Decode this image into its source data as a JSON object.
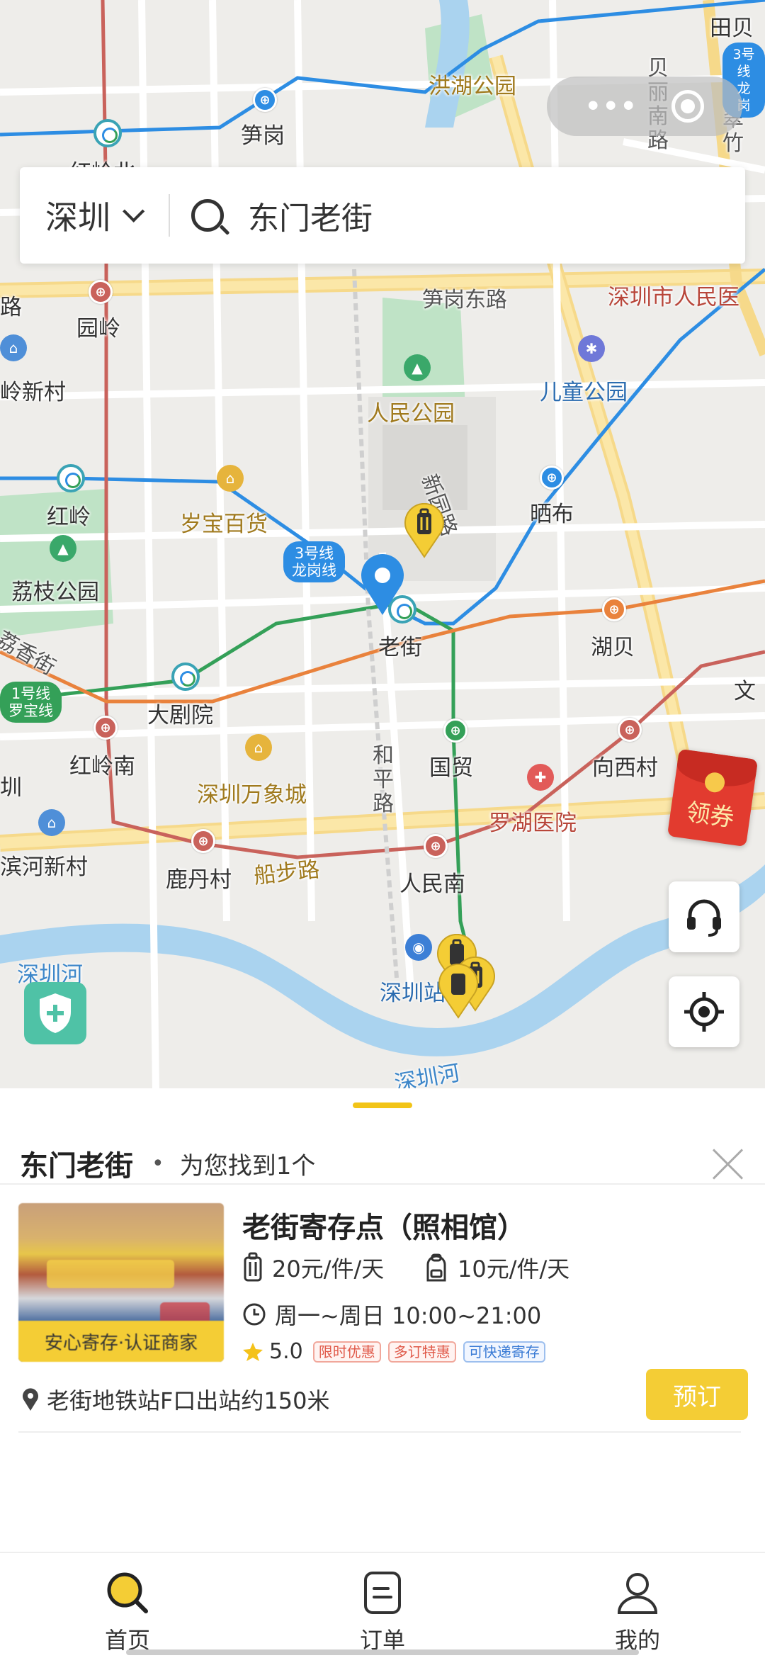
{
  "search": {
    "city": "深圳",
    "query": "东门老街"
  },
  "map": {
    "labels": {
      "honghu_park": "洪湖公园",
      "sungang": "笋岗",
      "hongling_north": "红岭北",
      "sungang_east_rd": "笋岗东路",
      "shenzhen_peoples_hospital": "深圳市人民医",
      "yuanling": "园岭",
      "childrens_park": "儿童公园",
      "peoples_park": "人民公园",
      "xinyuan_rd": "新园路",
      "hongling": "红岭",
      "suibao_dept_store": "岁宝百货",
      "shaibu": "晒布",
      "lizhi_park": "荔枝公园",
      "laojie": "老街",
      "hubei": "湖贝",
      "lixiang_st": "荔香街",
      "grand_theater": "大剧院",
      "hongling_south": "红岭南",
      "guomao": "国贸",
      "xiangxicun": "向西村",
      "mixc": "深圳万象城",
      "heping_rd": "和平路",
      "luohu_hospital": "罗湖医院",
      "binhe_xincun": "滨河新村",
      "ludancun": "鹿丹村",
      "pedestrian_rd": "船步路",
      "renmin_south": "人民南",
      "shenzhen_river": "深圳河",
      "shenzhen_river_2": "深圳河",
      "shenzhen_station": "深圳站",
      "beili_south_rd": "贝丽南路",
      "tianbei": "田贝",
      "cuizhu": "翠竹",
      "ling_xincun": "岭新村",
      "left_rd": "路",
      "left_hill": "圳",
      "wen": "文"
    },
    "line_badges": {
      "line3": "3号线\n龙岗线",
      "line1": "1号线\n罗宝线",
      "line3_top": "3号线\n龙岗"
    },
    "coupon_label": "领券"
  },
  "results": {
    "title": "东门老街",
    "count_text": "为您找到1个"
  },
  "store": {
    "name": "老街寄存点（照相馆）",
    "thumb_badge": "安心寄存·认证商家",
    "price_large": "20元/件/天",
    "price_small": "10元/件/天",
    "hours": "周一~周日 10:00~21:00",
    "rating": "5.0",
    "tags": [
      "限时优惠",
      "多订特惠",
      "可快递寄存"
    ],
    "address": "老街地铁站F口出站约150米",
    "book_label": "预订"
  },
  "tabs": [
    {
      "label": "首页",
      "icon": "search-icon",
      "active": true
    },
    {
      "label": "订单",
      "icon": "order-icon",
      "active": false
    },
    {
      "label": "我的",
      "icon": "profile-icon",
      "active": false
    }
  ],
  "colors": {
    "accent": "#f4cd35",
    "metro_green": "#34a058",
    "metro_blue": "#2d8de3",
    "metro_orange": "#e9823c",
    "tag_red": "#e05a4a",
    "tag_blue": "#3a7bd5"
  }
}
